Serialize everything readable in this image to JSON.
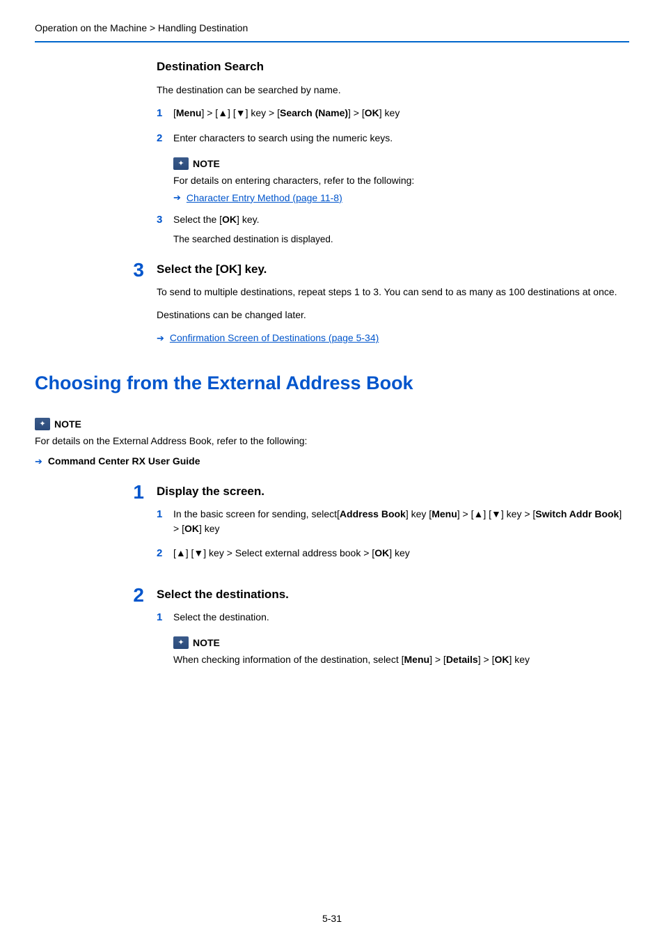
{
  "breadcrumb": "Operation on the Machine > Handling Destination",
  "destSearch": {
    "title": "Destination Search",
    "intro": "The destination can be searched by name.",
    "step1_pre": "[",
    "step1_menu": "Menu",
    "step1_mid1": "] > [▲] [▼] key > [",
    "step1_search": "Search (Name)",
    "step1_mid2": "] > [",
    "step1_ok": "OK",
    "step1_post": "] key",
    "step2": "Enter characters to search using the numeric keys.",
    "noteLabel": "NOTE",
    "noteText": "For details on entering characters, refer to the following:",
    "noteLink": "Character Entry Method (page 11-8)",
    "step3_pre": "Select the [",
    "step3_ok": "OK",
    "step3_post": "] key.",
    "step3_sub": "The searched destination is displayed."
  },
  "bigStep3": {
    "num": "3",
    "title": "Select the [OK] key.",
    "p1": "To send to multiple destinations, repeat steps 1 to 3. You can send to as many as 100 destinations at once.",
    "p2": "Destinations can be changed later.",
    "link": "Confirmation Screen of Destinations (page 5-34)"
  },
  "h1": "Choosing from the External Address Book",
  "extNote": {
    "label": "NOTE",
    "text": "For details on the External Address Book, refer to the following:",
    "ref": "Command Center RX User Guide"
  },
  "bigStep1": {
    "num": "1",
    "title": "Display the screen.",
    "s1_pre": "In the basic screen for sending, select[",
    "s1_ab": "Address Book",
    "s1_mid1": "] key [",
    "s1_menu": "Menu",
    "s1_mid2": "] > [▲] [▼] key > [",
    "s1_switch": "Switch Addr Book",
    "s1_mid3": "] > [",
    "s1_ok": "OK",
    "s1_post": "] key",
    "s2_pre": "[▲] [▼] key > Select external address book > [",
    "s2_ok": "OK",
    "s2_post": "] key"
  },
  "bigStep2": {
    "num": "2",
    "title": "Select the destinations.",
    "s1": "Select the destination.",
    "noteLabel": "NOTE",
    "note_pre": "When checking information of the destination, select [",
    "note_menu": "Menu",
    "note_mid1": "] > [",
    "note_details": "Details",
    "note_mid2": "] > [",
    "note_ok": "OK",
    "note_post": "] key"
  },
  "pageNum": "5-31",
  "markers": {
    "m1": "1",
    "m2": "2",
    "m3": "3"
  }
}
